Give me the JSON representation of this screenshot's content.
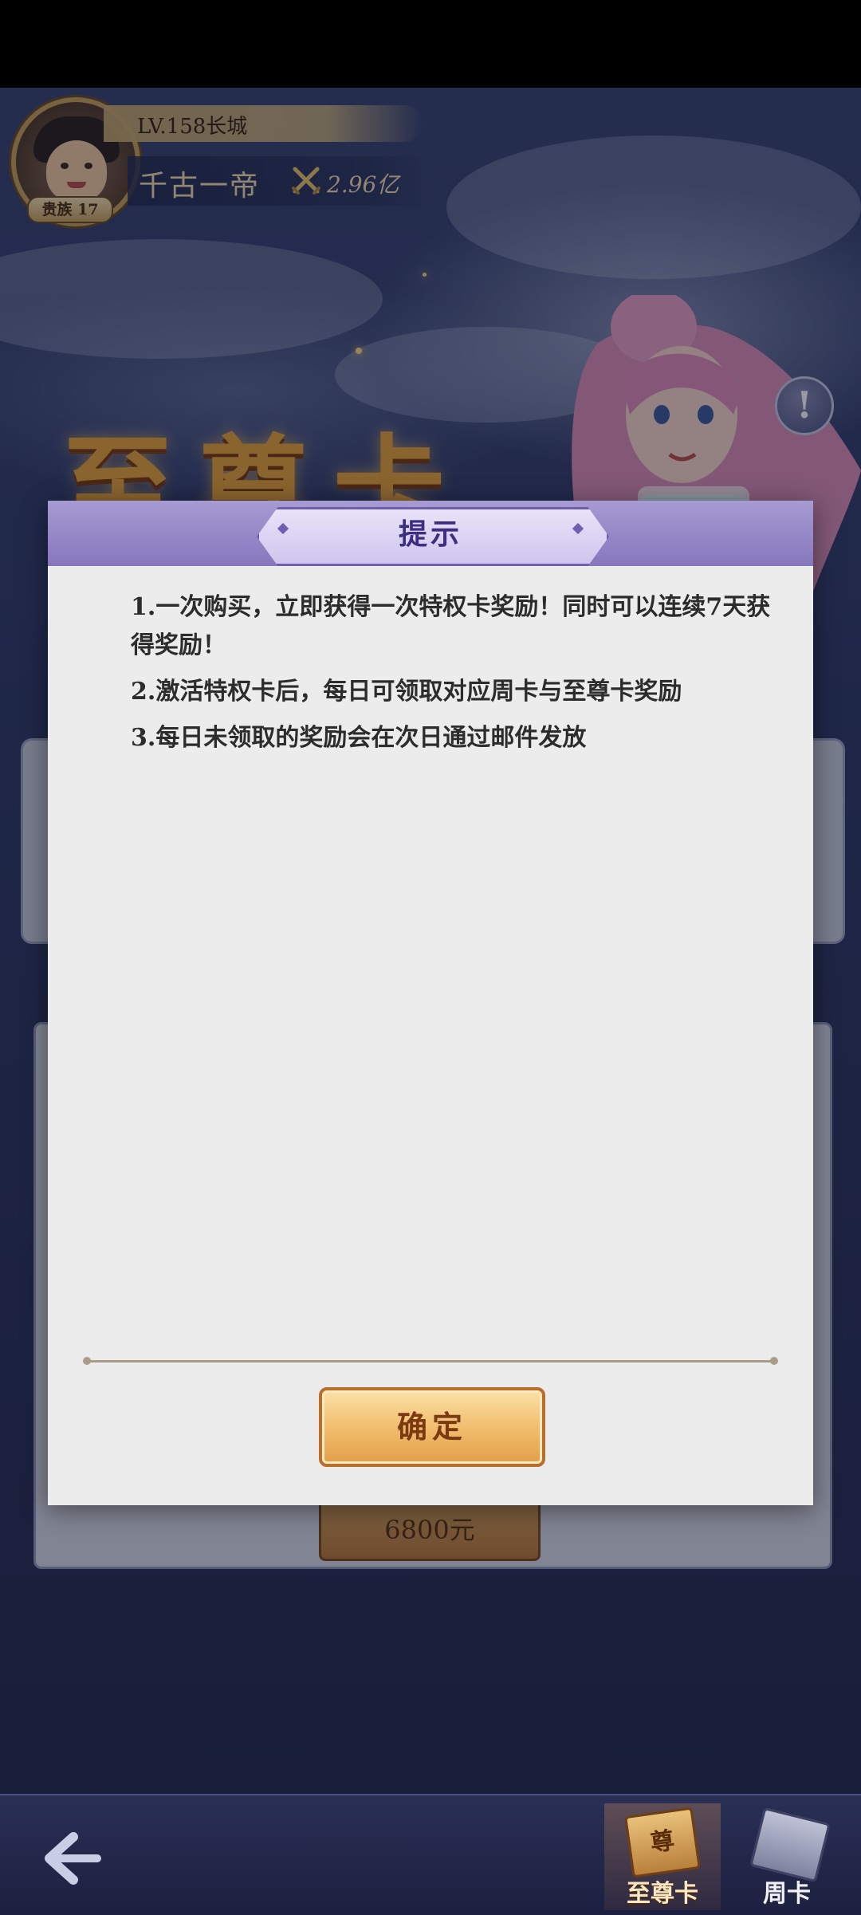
{
  "player": {
    "level_text": "LV.158长城",
    "name": "千古一帝",
    "power": "2.96亿",
    "noble_label": "贵族 17"
  },
  "banner": {
    "title": "至尊卡"
  },
  "background": {
    "buy_button_label": "6800元"
  },
  "dialog": {
    "title": "提示",
    "rules": [
      "1.一次购买，立即获得一次特权卡奖励！同时可以连续7天获得奖励！",
      "2.激活特权卡后，每日可领取对应周卡与至尊卡奖励",
      "3.每日未领取的奖励会在次日通过邮件发放"
    ],
    "confirm_label": "确定"
  },
  "tabs": {
    "supreme_label": "至尊卡",
    "supreme_card_glyph": "尊",
    "week_label": "周卡"
  },
  "colors": {
    "dialog_header": "#8677bd",
    "title_text": "#3d2f80",
    "confirm_button": "#f0bb6a"
  },
  "icons": {
    "back": "back-arrow-icon",
    "power": "crossed-swords-icon",
    "info": "exclamation-icon"
  }
}
